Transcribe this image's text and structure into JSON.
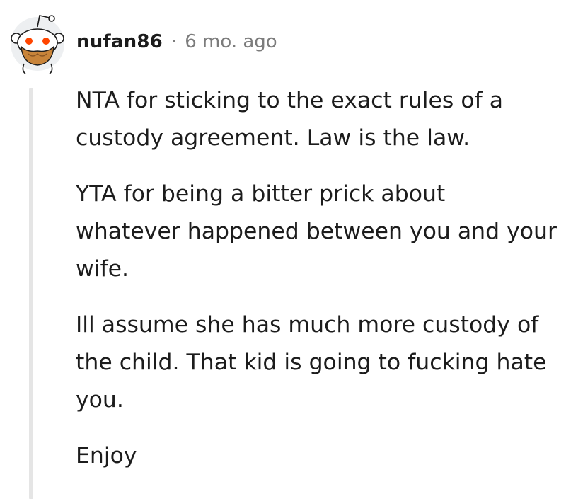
{
  "comment": {
    "avatar_icon": "snoo-bearded-avatar-icon",
    "username": "nufan86",
    "separator": "·",
    "timestamp": "6 mo. ago",
    "paragraphs": [
      "NTA for sticking to the exact rules of a custody agreement. Law is the law.",
      "YTA for being a bitter prick about whatever happened between you and your wife.",
      "Ill assume she has much more custody of the child. That kid is going to fucking hate you.",
      "Enjoy"
    ],
    "colors": {
      "text": "#1c1c1c",
      "meta": "#7c7c7c",
      "thread_line": "#e5e5e5",
      "snoo_eye": "#ff4500",
      "beard": "#c8843a"
    }
  }
}
